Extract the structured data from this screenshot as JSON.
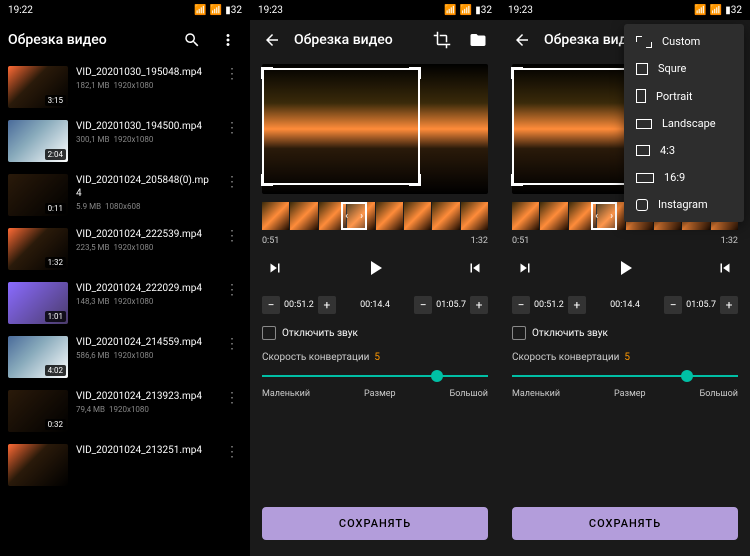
{
  "status": {
    "time1": "19:22",
    "time2": "19:23",
    "time3": "19:23",
    "battery": "32"
  },
  "screen1": {
    "title": "Обрезка видео",
    "videos": [
      {
        "name": "VID_20201030_195048.mp4",
        "size": "182,1 MB",
        "res": "1920x1080",
        "dur": "3:15"
      },
      {
        "name": "VID_20201030_194500.mp4",
        "size": "300,1 MB",
        "res": "1920x1080",
        "dur": "2:04"
      },
      {
        "name": "VID_20201024_205848(0).mp4",
        "size": "5.9 MB",
        "res": "1080x608",
        "dur": "0:11"
      },
      {
        "name": "VID_20201024_222539.mp4",
        "size": "223,5 MB",
        "res": "1920x1080",
        "dur": "1:32"
      },
      {
        "name": "VID_20201024_222029.mp4",
        "size": "148,3 MB",
        "res": "1920x1080",
        "dur": "1:01"
      },
      {
        "name": "VID_20201024_214559.mp4",
        "size": "586,6 MB",
        "res": "1920x1080",
        "dur": "4:02"
      },
      {
        "name": "VID_20201024_213923.mp4",
        "size": "79,4 MB",
        "res": "1920x1080",
        "dur": "0:32"
      },
      {
        "name": "VID_20201024_213251.mp4",
        "size": "",
        "res": "",
        "dur": ""
      }
    ]
  },
  "editor": {
    "title": "Обрезка видео",
    "title_trunc": "Обрезка вид",
    "tl_start": "0:51",
    "tl_end": "1:32",
    "t_start": "00:51.2",
    "t_mid": "00:14.4",
    "t_end": "01:05.7",
    "mute_label": "Отключить звук",
    "speed_label": "Скорость конвертации",
    "speed_value": "5",
    "size_small": "Маленький",
    "size_mid": "Размер",
    "size_big": "Большой",
    "save": "СОХРАНЯТЬ"
  },
  "aspect_menu": {
    "items": [
      "Custom",
      "Squre",
      "Portrait",
      "Landscape",
      "4:3",
      "16:9",
      "Instagram"
    ]
  }
}
